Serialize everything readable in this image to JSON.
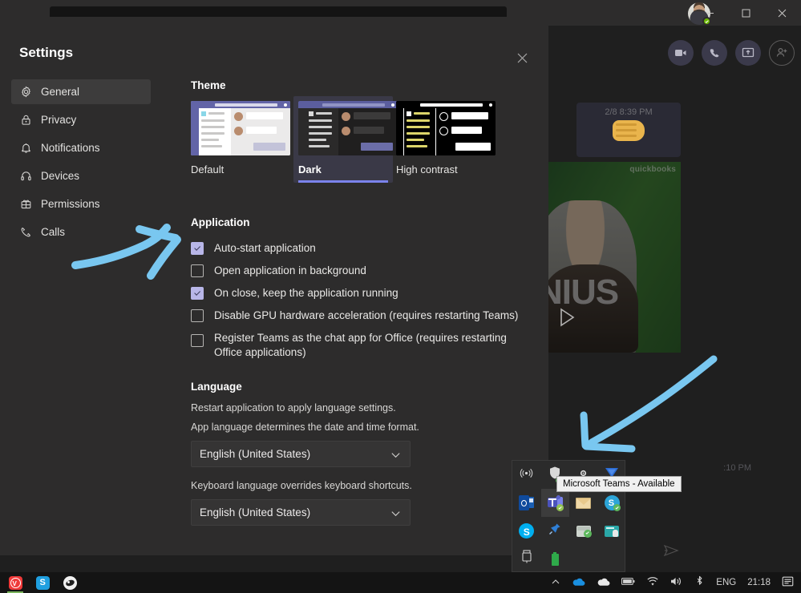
{
  "window": {
    "controls": {
      "minimize": "minimize",
      "maximize": "maximize",
      "close": "close"
    },
    "avatar_presence": "Available"
  },
  "chat": {
    "actions": [
      "video-call",
      "audio-call",
      "share-screen",
      "add-people"
    ],
    "messages": [
      {
        "time": "2/8 8:39 PM",
        "emoji": "fist-bump"
      }
    ],
    "video": {
      "watermark": "quickbooks",
      "overlay_text": "NIUS"
    },
    "second_time": ":10 PM",
    "send_label": "send"
  },
  "settings": {
    "title": "Settings",
    "close_label": "Close",
    "sidebar": {
      "items": [
        {
          "label": "General",
          "icon": "gear-icon",
          "active": true
        },
        {
          "label": "Privacy",
          "icon": "lock-icon",
          "active": false
        },
        {
          "label": "Notifications",
          "icon": "bell-icon",
          "active": false
        },
        {
          "label": "Devices",
          "icon": "headset-icon",
          "active": false
        },
        {
          "label": "Permissions",
          "icon": "permissions-icon",
          "active": false
        },
        {
          "label": "Calls",
          "icon": "phone-icon",
          "active": false
        }
      ]
    },
    "theme": {
      "title": "Theme",
      "options": [
        {
          "label": "Default",
          "selected": false
        },
        {
          "label": "Dark",
          "selected": true
        },
        {
          "label": "High contrast",
          "selected": false
        }
      ]
    },
    "application": {
      "title": "Application",
      "options": [
        {
          "label": "Auto-start application",
          "checked": true
        },
        {
          "label": "Open application in background",
          "checked": false
        },
        {
          "label": "On close, keep the application running",
          "checked": true
        },
        {
          "label": "Disable GPU hardware acceleration (requires restarting Teams)",
          "checked": false
        },
        {
          "label": "Register Teams as the chat app for Office (requires restarting Office applications)",
          "checked": false
        }
      ]
    },
    "language": {
      "title": "Language",
      "restart_hint": "Restart application to apply language settings.",
      "app_language_hint": "App language determines the date and time format.",
      "app_language_value": "English (United States)",
      "keyboard_language_hint": "Keyboard language overrides keyboard shortcuts.",
      "keyboard_language_value": "English (United States)"
    }
  },
  "tray": {
    "tooltip": "Microsoft Teams - Available",
    "icons": [
      "broadcast-icon",
      "windows-defender-icon",
      "settings-circle-icon",
      "vpn-icon",
      "outlook-icon",
      "microsoft-teams-icon",
      "mail-icon",
      "skype-for-business-icon",
      "skype-icon",
      "pin-tool-icon",
      "backup-check-icon",
      "clipboard-icon",
      "usb-device-icon",
      "battery-icon"
    ],
    "highlighted": "microsoft-teams-icon"
  },
  "taskbar": {
    "apps": [
      "vivaldi-icon",
      "skype-icon",
      "whiteboard-icon"
    ],
    "tray": {
      "show_hidden": "chevron-up-icon",
      "onedrive_blue": "onedrive-blue-icon",
      "onedrive_white": "onedrive-white-icon",
      "battery": "battery-icon",
      "network": "wifi-icon",
      "volume": "speaker-icon",
      "bluetooth": "bluetooth-icon",
      "language": "ENG",
      "clock": "21:18",
      "notifications": "notification-icon"
    }
  },
  "annotations": {
    "arrow_color": "#79c7f0",
    "arrow_1": "points-right-at-open-application-in-background",
    "arrow_2": "points-down-left-at-system-tray"
  }
}
